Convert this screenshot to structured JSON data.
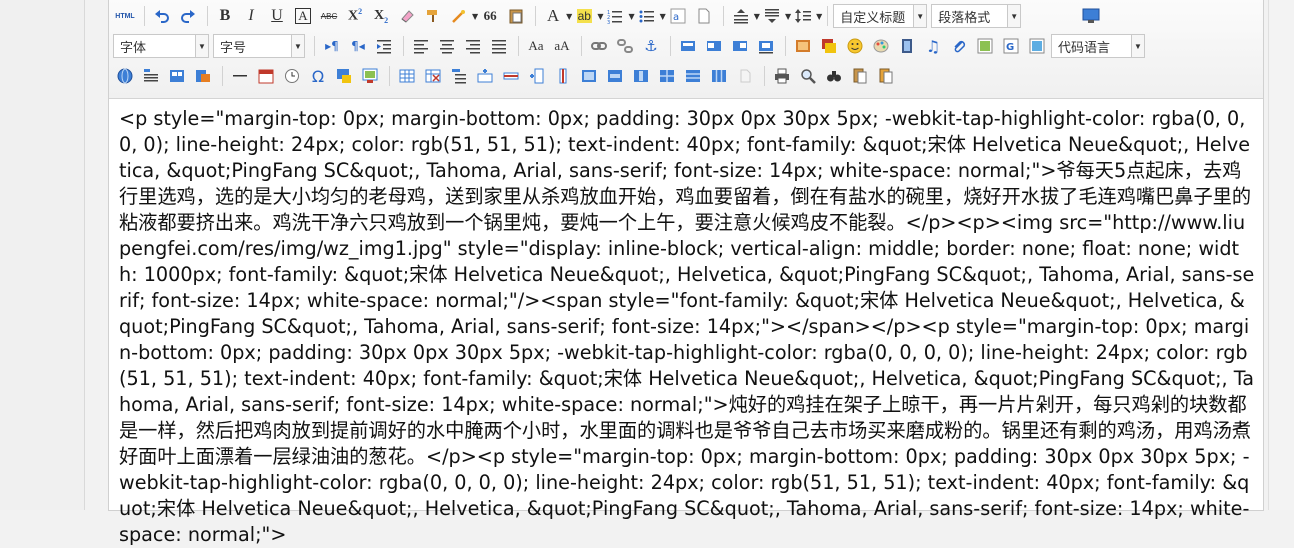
{
  "toolbar": {
    "custom_title_label": "自定义标题",
    "paragraph_format_label": "段落格式",
    "font_family_label": "字体",
    "font_size_label": "字号",
    "code_language_label": "代码语言",
    "html_label": "HTML",
    "bold_label": "B",
    "italic_label": "I",
    "underline_label": "U",
    "strike_label": "ABC",
    "font_color_label": "A",
    "quote_label": "66",
    "omega_label": "Ω"
  },
  "content": {
    "source_html": "<p style=\"margin-top: 0px; margin-bottom: 0px; padding: 30px 0px 30px 5px; -webkit-tap-highlight-color: rgba(0, 0, 0, 0); line-height: 24px; color: rgb(51, 51, 51); text-indent: 40px; font-family: &quot;宋体 Helvetica Neue&quot;, Helvetica, &quot;PingFang SC&quot;, Tahoma, Arial, sans-serif; font-size: 14px; white-space: normal;\">爷每天5点起床，去鸡行里选鸡，选的是大小均匀的老母鸡，送到家里从杀鸡放血开始，鸡血要留着，倒在有盐水的碗里，烧好开水拔了毛连鸡嘴巴鼻子里的粘液都要挤出来。鸡洗干净六只鸡放到一个锅里炖，要炖一个上午，要注意火候鸡皮不能裂。</p><p><img src=\"http://www.liupengfei.com/res/img/wz_img1.jpg\" style=\"display: inline-block; vertical-align: middle; border: none; float: none; width: 1000px; font-family: &quot;宋体 Helvetica Neue&quot;, Helvetica, &quot;PingFang SC&quot;, Tahoma, Arial, sans-serif; font-size: 14px; white-space: normal;\"/><span style=\"font-family: &quot;宋体 Helvetica Neue&quot;, Helvetica, &quot;PingFang SC&quot;, Tahoma, Arial, sans-serif; font-size: 14px;\"></span></p><p style=\"margin-top: 0px; margin-bottom: 0px; padding: 30px 0px 30px 5px; -webkit-tap-highlight-color: rgba(0, 0, 0, 0); line-height: 24px; color: rgb(51, 51, 51); text-indent: 40px; font-family: &quot;宋体 Helvetica Neue&quot;, Helvetica, &quot;PingFang SC&quot;, Tahoma, Arial, sans-serif; font-size: 14px; white-space: normal;\">炖好的鸡挂在架子上晾干，再一片片剁开，每只鸡剁的块数都是一样，然后把鸡肉放到提前调好的水中腌两个小时，水里面的调料也是爷爷自己去市场买来磨成粉的。锅里还有剩的鸡汤，用鸡汤煮好面叶上面漂着一层绿油油的葱花。</p><p style=\"margin-top: 0px; margin-bottom: 0px; padding: 30px 0px 30px 5px; -webkit-tap-highlight-color: rgba(0, 0, 0, 0); line-height: 24px; color: rgb(51, 51, 51); text-indent: 40px; font-family: &quot;宋体 Helvetica Neue&quot;, Helvetica, &quot;PingFang SC&quot;, Tahoma, Arial, sans-serif; font-size: 14px; white-space: normal;\">"
  }
}
